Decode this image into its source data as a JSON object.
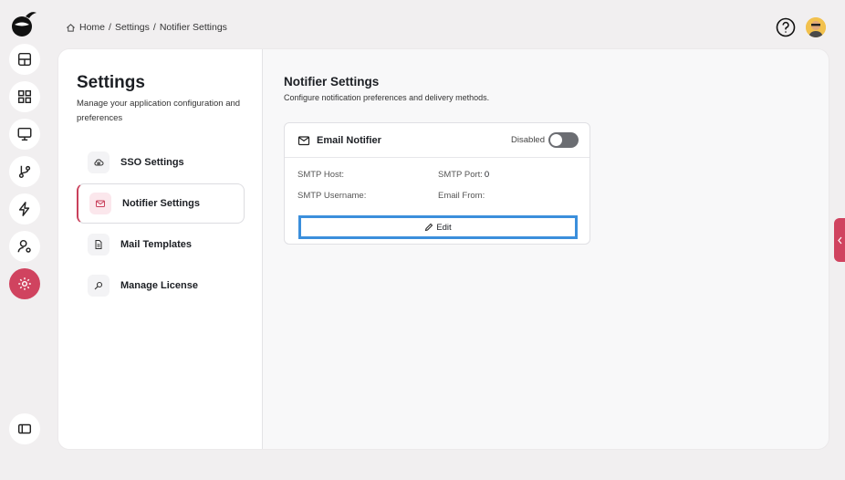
{
  "breadcrumb": {
    "home": "Home",
    "sep1": "/",
    "settings": "Settings",
    "sep2": "/",
    "current": "Notifier Settings"
  },
  "rail": {
    "items": [
      {
        "name": "dashboard-icon"
      },
      {
        "name": "apps-icon"
      },
      {
        "name": "monitor-icon"
      },
      {
        "name": "git-branch-icon"
      },
      {
        "name": "lightning-icon"
      },
      {
        "name": "user-settings-icon"
      },
      {
        "name": "gear-icon",
        "active": true
      }
    ],
    "active_color": "#d0435f"
  },
  "settings": {
    "title": "Settings",
    "description": "Manage your application configuration and preferences",
    "nav": [
      {
        "label": "SSO Settings",
        "icon": "cloud-lock-icon"
      },
      {
        "label": "Notifier Settings",
        "icon": "mail-icon",
        "active": true
      },
      {
        "label": "Mail Templates",
        "icon": "document-icon"
      },
      {
        "label": "Manage License",
        "icon": "key-icon"
      }
    ]
  },
  "content": {
    "title": "Notifier Settings",
    "subtitle": "Configure notification preferences and delivery methods."
  },
  "notifier": {
    "title": "Email Notifier",
    "status": "Disabled",
    "enabled": false,
    "smtp_host_label": "SMTP Host",
    "smtp_host_value": "",
    "smtp_port_label": "SMTP Port",
    "smtp_port_value": "0",
    "smtp_username_label": "SMTP Username",
    "smtp_username_value": "",
    "email_from_label": "Email From",
    "email_from_value": "",
    "edit_label": "Edit"
  }
}
